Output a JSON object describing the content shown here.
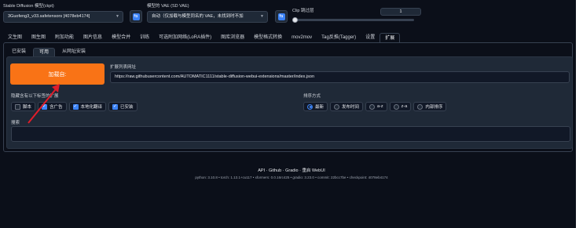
{
  "header": {
    "checkpoint_label": "Stable Diffusion 模型(ckpt)",
    "checkpoint_value": "3Guofeng3_v33.safetensors [4078eb4174]",
    "vae_label": "模型的 VAE (SD VAE)",
    "vae_value": "自动（仅加载与模型同名的 VAE，未找到时不加",
    "clip_label": "Clip 跳过层",
    "clip_value": "1",
    "refresh_icon": "refresh-icon",
    "dropdown_icon": "chevron-down-icon"
  },
  "tabs": [
    {
      "label": "文生图"
    },
    {
      "label": "图生图"
    },
    {
      "label": "附加功能"
    },
    {
      "label": "图片信息"
    },
    {
      "label": "模型合并"
    },
    {
      "label": "训练"
    },
    {
      "label": "可选附加网络(LoRA插件)"
    },
    {
      "label": "图库浏览器"
    },
    {
      "label": "模型格式转换"
    },
    {
      "label": "mov2mov"
    },
    {
      "label": "Tag反推(Tagger)"
    },
    {
      "label": "设置"
    },
    {
      "label": "扩展"
    }
  ],
  "subtabs": [
    {
      "label": "已安装"
    },
    {
      "label": "可用"
    },
    {
      "label": "从网址安装"
    }
  ],
  "extensions": {
    "load_button": "加载自:",
    "url_label": "扩展列表网址",
    "url_value": "https://raw.githubusercontent.com/AUTOMATIC1111/stable-diffusion-webui-extensions/master/index.json",
    "hide_label": "隐藏含有以下标签的扩展",
    "hide_options": [
      {
        "label": "脚本",
        "checked": false
      },
      {
        "label": "含广告",
        "checked": true
      },
      {
        "label": "本地化翻译",
        "checked": true
      },
      {
        "label": "已安装",
        "checked": true
      }
    ],
    "sort_label": "排序方式",
    "sort_options": [
      {
        "label": "最新",
        "selected": true
      },
      {
        "label": "发布时间",
        "selected": false
      },
      {
        "label": "a-z",
        "selected": false
      },
      {
        "label": "z-a",
        "selected": false
      },
      {
        "label": "内部排序",
        "selected": false
      }
    ],
    "search_label": "搜索",
    "search_value": ""
  },
  "footer": {
    "links": "API · Github · Gradio · 重启 WebUI",
    "info": "python: 3.10.8  •  torch: 1.13.1+cu117  •  xformers: 0.0.16rc425  •  gradio: 3.23.0  •  commit: 22bcc7be  •  checkpoint: 4078eb4174"
  },
  "annotation": {
    "color": "#e11d2a"
  }
}
